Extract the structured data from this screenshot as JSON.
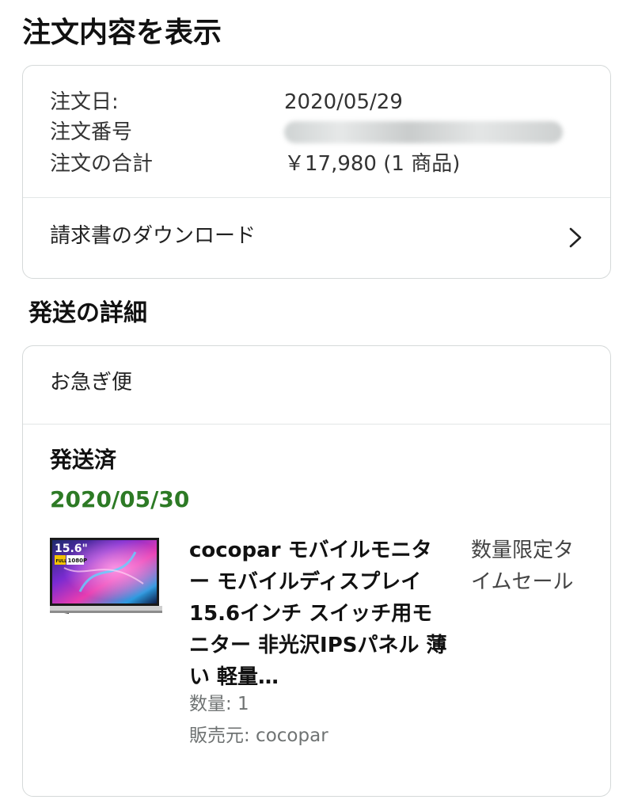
{
  "header": {
    "title": "注文内容を表示"
  },
  "order_summary": {
    "date_label": "注文日:",
    "date_value": "2020/05/29",
    "number_label": "注文番号",
    "total_label": "注文の合計",
    "total_value": "￥17,980 (1 商品)",
    "invoice_label": "請求書のダウンロード"
  },
  "shipping": {
    "section_title": "発送の詳細",
    "speed": "お急ぎ便",
    "status": "発送済",
    "date": "2020/05/30",
    "status_color": "#2d7a25",
    "item": {
      "title": "cocopar モバイルモニター モバイルディスプレイ 15.6インチ スイッチ用モニター 非光沢IPSパネル 薄い 軽量…",
      "promo": "数量限定タイムセール",
      "quantity": "数量: 1",
      "seller": "販売元: cocopar",
      "thumb_badge_size": "15.6\"",
      "thumb_badge_res": "1080P",
      "thumb_badge_full": "FULL HD"
    }
  },
  "icons": {
    "invoice_arrow": "chevron-right-icon",
    "product_image": "monitor-thumbnail"
  }
}
